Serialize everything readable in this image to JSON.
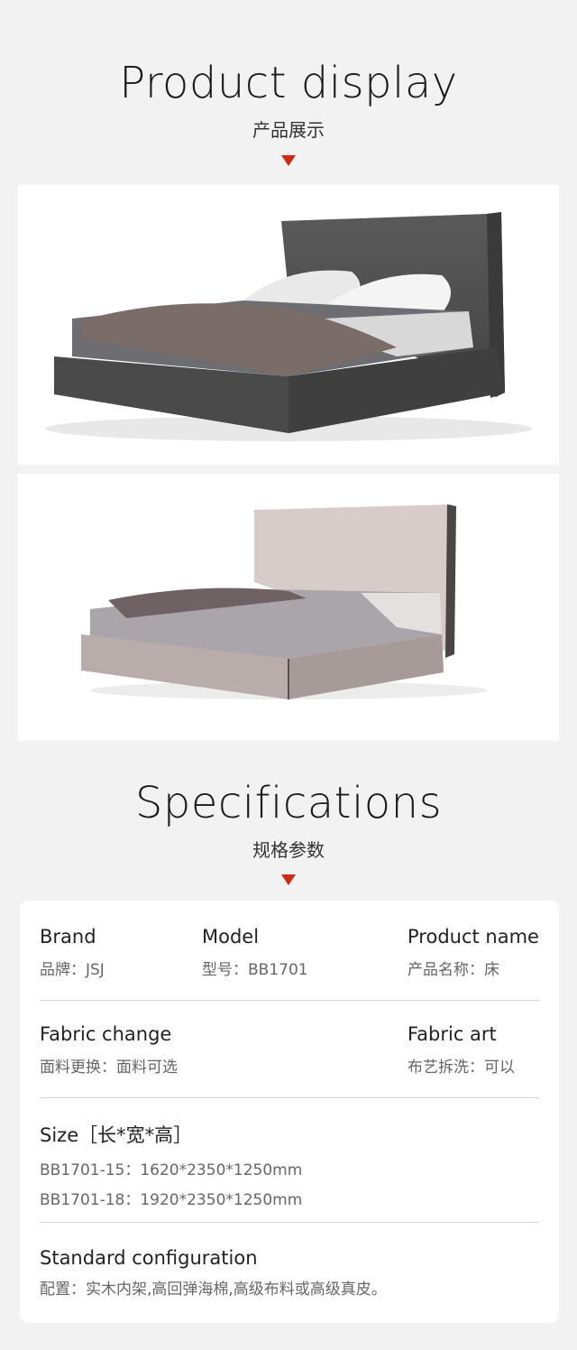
{
  "display": {
    "title": "Product display",
    "subtitle": "产品展示"
  },
  "specs": {
    "title": "Specifications",
    "subtitle": "规格参数"
  },
  "accent_color": "#d12a12",
  "card": {
    "brand": {
      "label": "Brand",
      "value": "品牌：JSJ"
    },
    "model": {
      "label": "Model",
      "value": "型号：BB1701"
    },
    "product_name": {
      "label": "Product name",
      "value": "产品名称：床"
    },
    "fabric_change": {
      "label": "Fabric change",
      "value": "面料更换：面料可选"
    },
    "fabric_art": {
      "label": "Fabric art",
      "value": "布艺拆洗：可以"
    },
    "size": {
      "label": "Size［长*宽*高］",
      "lines": [
        "BB1701-15：1620*2350*1250mm",
        "BB1701-18：1920*2350*1250mm"
      ]
    },
    "standard": {
      "label": "Standard configuration",
      "value": "配置：实木内架,高回弹海棉,高级布料或高级真皮。"
    }
  }
}
